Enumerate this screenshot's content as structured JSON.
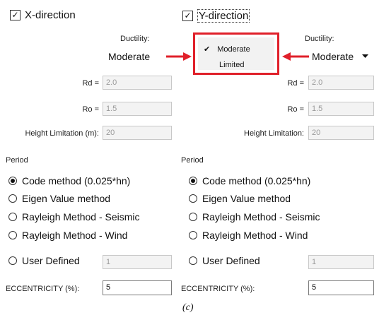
{
  "x_direction": {
    "label": "X-direction",
    "checked": true,
    "ductility_label": "Ductility:",
    "ductility_value": "Moderate",
    "rd_label": "Rd =",
    "rd_value": "2.0",
    "ro_label": "Ro =",
    "ro_value": "1.5",
    "height_label": "Height Limitation (m):",
    "height_value": "20",
    "period_label": "Period",
    "period_options": [
      "Code method (0.025*hn)",
      "Eigen Value method",
      "Rayleigh Method - Seismic",
      "Rayleigh Method - Wind",
      "User Defined"
    ],
    "selected_period": "Code method (0.025*hn)",
    "user_defined_value": "1",
    "eccentricity_label": "ECCENTRICITY (%):",
    "eccentricity_value": "5"
  },
  "y_direction": {
    "label": "Y-direction",
    "checked": true,
    "ductility_label": "Ductility:",
    "ductility_value": "Moderate",
    "rd_label": "Rd =",
    "rd_value": "2.0",
    "ro_label": "Ro =",
    "ro_value": "1.5",
    "height_label": "Height Limitation:",
    "height_value": "20",
    "period_label": "Period",
    "period_options": [
      "Code method (0.025*hn)",
      "Eigen Value method",
      "Rayleigh Method - Seismic",
      "Rayleigh Method - Wind",
      "User Defined"
    ],
    "selected_period": "Code method (0.025*hn)",
    "user_defined_value": "1",
    "eccentricity_label": "ECCENTRICITY (%):",
    "eccentricity_value": "5"
  },
  "ductility_menu": {
    "options": [
      "Moderate",
      "Limited"
    ],
    "selected": "Moderate"
  },
  "icons": {
    "check": "checkmark-icon",
    "dropdown": "chevron-down-icon",
    "arrow": "red-arrow-icon"
  },
  "colors": {
    "highlight": "#e0202a"
  },
  "caption": "(c)"
}
